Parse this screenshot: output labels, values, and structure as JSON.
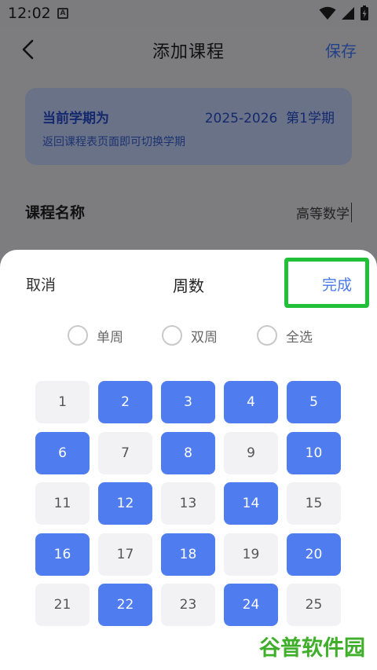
{
  "status": {
    "time": "12:02",
    "a_icon": "A"
  },
  "header": {
    "title": "添加课程",
    "save_label": "保存"
  },
  "semester": {
    "label": "当前学期为",
    "value": "2025-2026  第1学期",
    "hint": "返回课程表页面即可切换学期"
  },
  "course": {
    "label": "课程名称",
    "value": "高等数学"
  },
  "sheet": {
    "cancel_label": "取消",
    "title": "周数",
    "done_label": "完成",
    "radios": [
      "单周",
      "双周",
      "全选"
    ],
    "weeks": [
      {
        "n": "1",
        "on": false
      },
      {
        "n": "2",
        "on": true
      },
      {
        "n": "3",
        "on": true
      },
      {
        "n": "4",
        "on": true
      },
      {
        "n": "5",
        "on": true
      },
      {
        "n": "6",
        "on": true
      },
      {
        "n": "7",
        "on": false
      },
      {
        "n": "8",
        "on": true
      },
      {
        "n": "9",
        "on": false
      },
      {
        "n": "10",
        "on": true
      },
      {
        "n": "11",
        "on": false
      },
      {
        "n": "12",
        "on": true
      },
      {
        "n": "13",
        "on": false
      },
      {
        "n": "14",
        "on": true
      },
      {
        "n": "15",
        "on": false
      },
      {
        "n": "16",
        "on": true
      },
      {
        "n": "17",
        "on": false
      },
      {
        "n": "18",
        "on": true
      },
      {
        "n": "19",
        "on": false
      },
      {
        "n": "20",
        "on": true
      },
      {
        "n": "21",
        "on": false
      },
      {
        "n": "22",
        "on": true
      },
      {
        "n": "23",
        "on": false
      },
      {
        "n": "24",
        "on": true
      },
      {
        "n": "25",
        "on": false
      }
    ]
  },
  "watermark": {
    "text": "谷普软件园"
  },
  "colors": {
    "accent": "#4f7df0",
    "highlight_box": "#21c038",
    "cell_off": "#f2f2f4"
  }
}
